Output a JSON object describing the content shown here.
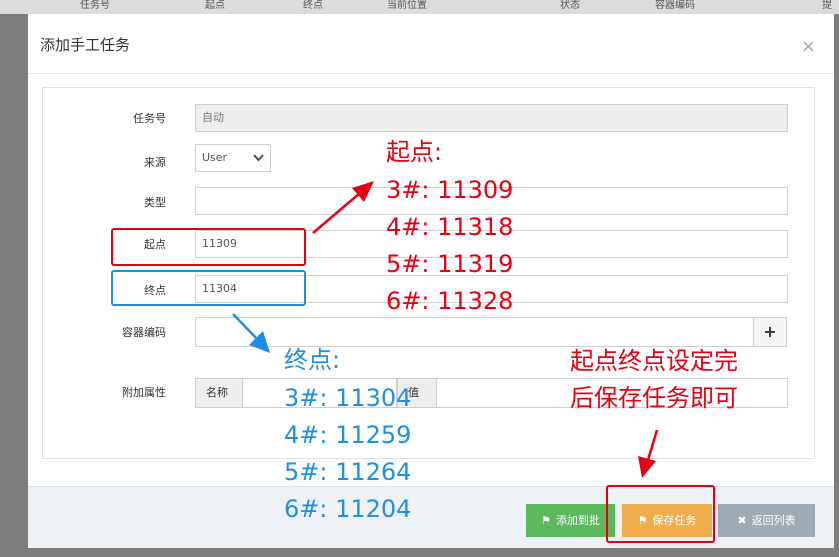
{
  "background_table": {
    "headers": [
      "任务号",
      "起点",
      "终点",
      "当前位置",
      "状态",
      "容器编码",
      "提"
    ]
  },
  "modal": {
    "title": "添加手工任务",
    "close_label": "×",
    "form": {
      "task_no": {
        "label": "任务号",
        "value": "自动"
      },
      "source": {
        "label": "来源",
        "value": "User"
      },
      "type": {
        "label": "类型",
        "value": ""
      },
      "start": {
        "label": "起点",
        "value": "11309"
      },
      "end": {
        "label": "终点",
        "value": "11304"
      },
      "container": {
        "label": "容器编码",
        "value": "",
        "add_label": "+"
      },
      "attrs": {
        "label": "附加属性",
        "name_label": "名称",
        "value_label": "值"
      }
    },
    "footer": {
      "add_batch": "添加到批",
      "save_task": "保存任务",
      "back_list": "返回列表"
    }
  },
  "annotations": {
    "start_title": "起点:",
    "start_lines": [
      "3#: 11309",
      "4#: 11318",
      "5#: 11319",
      "6#: 11328"
    ],
    "end_title": "终点:",
    "end_lines": [
      "3#: 11304",
      "4#: 11259",
      "5#: 11264",
      "6#: 11204"
    ],
    "instruction_lines": [
      "起点终点设定完",
      "后保存任务即可"
    ]
  },
  "colors": {
    "annotation_red": "#e60012",
    "annotation_blue": "#1e8fe6",
    "btn_green": "#5cb85c",
    "btn_orange": "#f0ad4e",
    "btn_gray": "#a0aab3"
  }
}
